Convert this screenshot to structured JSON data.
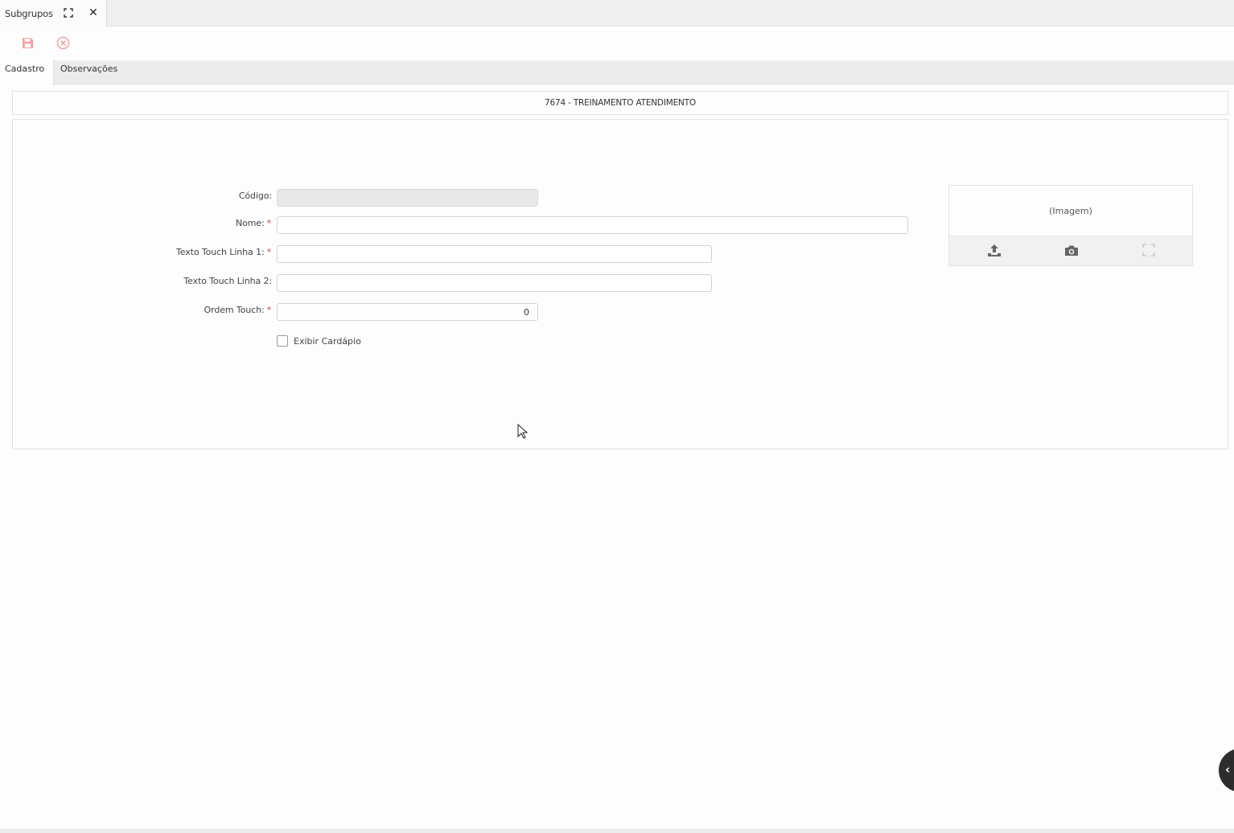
{
  "window": {
    "tab_title": "Subgrupos",
    "maximize_icon": "maximize-icon",
    "close_icon": "close-icon"
  },
  "toolbar": {
    "save_icon": "save-icon",
    "cancel_icon": "cancel-icon",
    "save_color": "#f2a3a3",
    "cancel_color": "#f2a3a3"
  },
  "tabs": [
    {
      "label": "Cadastro",
      "active": true
    },
    {
      "label": "Observações",
      "active": false
    }
  ],
  "record": {
    "header": "7674 - TREINAMENTO ATENDIMENTO"
  },
  "form": {
    "codigo": {
      "label": "Código:",
      "value": "",
      "required": false,
      "disabled": true
    },
    "nome": {
      "label": "Nome:",
      "value": "",
      "required": true
    },
    "texto_linha1": {
      "label": "Texto Touch Linha 1:",
      "value": "",
      "required": true
    },
    "texto_linha2": {
      "label": "Texto Touch Linha 2:",
      "value": "",
      "required": false
    },
    "ordem_touch": {
      "label": "Ordem Touch:",
      "value": "0",
      "required": true
    },
    "exibir_cardapio": {
      "label": "Exibir Cardápio",
      "checked": false
    },
    "required_mark": "*"
  },
  "image": {
    "placeholder": "(Imagem)",
    "upload_icon": "upload-icon",
    "camera_icon": "camera-icon",
    "expand_icon": "expand-icon"
  },
  "side_toggle": {
    "icon": "chevron-left-icon",
    "glyph": "‹"
  }
}
